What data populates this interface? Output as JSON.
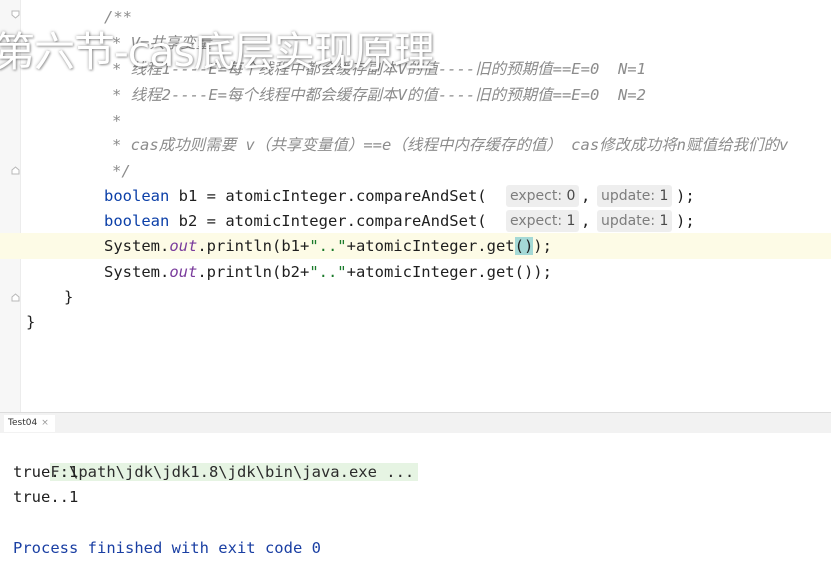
{
  "overlay": {
    "title": "第六节-cas底层实现原理"
  },
  "editor": {
    "comment_open": "/**",
    "comment_line1": "* V=共享变量",
    "comment_line2": "* 线程1----E=每个线程中都会缓存副本V的值----旧的预期值==E=0  N=1",
    "comment_line3": "* 线程2----E=每个线程中都会缓存副本V的值----旧的预期值==E=0  N=2",
    "comment_line4": "*",
    "comment_line5": "* cas成功则需要 v（共享变量值）==e（线程中内存缓存的值） cas修改成功将n赋值给我们的v",
    "comment_close": "*/",
    "line_b1": {
      "type": "boolean",
      "rest": " b1 = atomicInteger.compareAndSet(",
      "hint1_name": "expect:",
      "hint1_value": "0",
      "sep": ",",
      "hint2_name": "update:",
      "hint2_value": "1",
      "end": ");"
    },
    "line_b2": {
      "type": "boolean",
      "rest": " b2 = atomicInteger.compareAndSet(",
      "hint1_name": "expect:",
      "hint1_value": "1",
      "sep": ",",
      "hint2_name": "update:",
      "hint2_value": "1",
      "end": ");"
    },
    "line_p1": {
      "pre": "System.",
      "out": "out",
      "mid": ".println(b1+",
      "str": "\"..\"",
      "post": "+atomicInteger.get",
      "paren": "()",
      "end": ");"
    },
    "line_p2": {
      "pre": "System.",
      "out": "out",
      "mid": ".println(b2+",
      "str": "\"..\"",
      "post": "+atomicInteger.get());"
    },
    "close_method": "}",
    "close_class": "}"
  },
  "run_tab": {
    "label": "Test04",
    "close": "×"
  },
  "console": {
    "command": "F:\\path\\jdk\\jdk1.8\\jdk\\bin\\java.exe ...",
    "output": [
      "true..1",
      "true..1"
    ],
    "exit_message": "Process finished with exit code 0"
  }
}
